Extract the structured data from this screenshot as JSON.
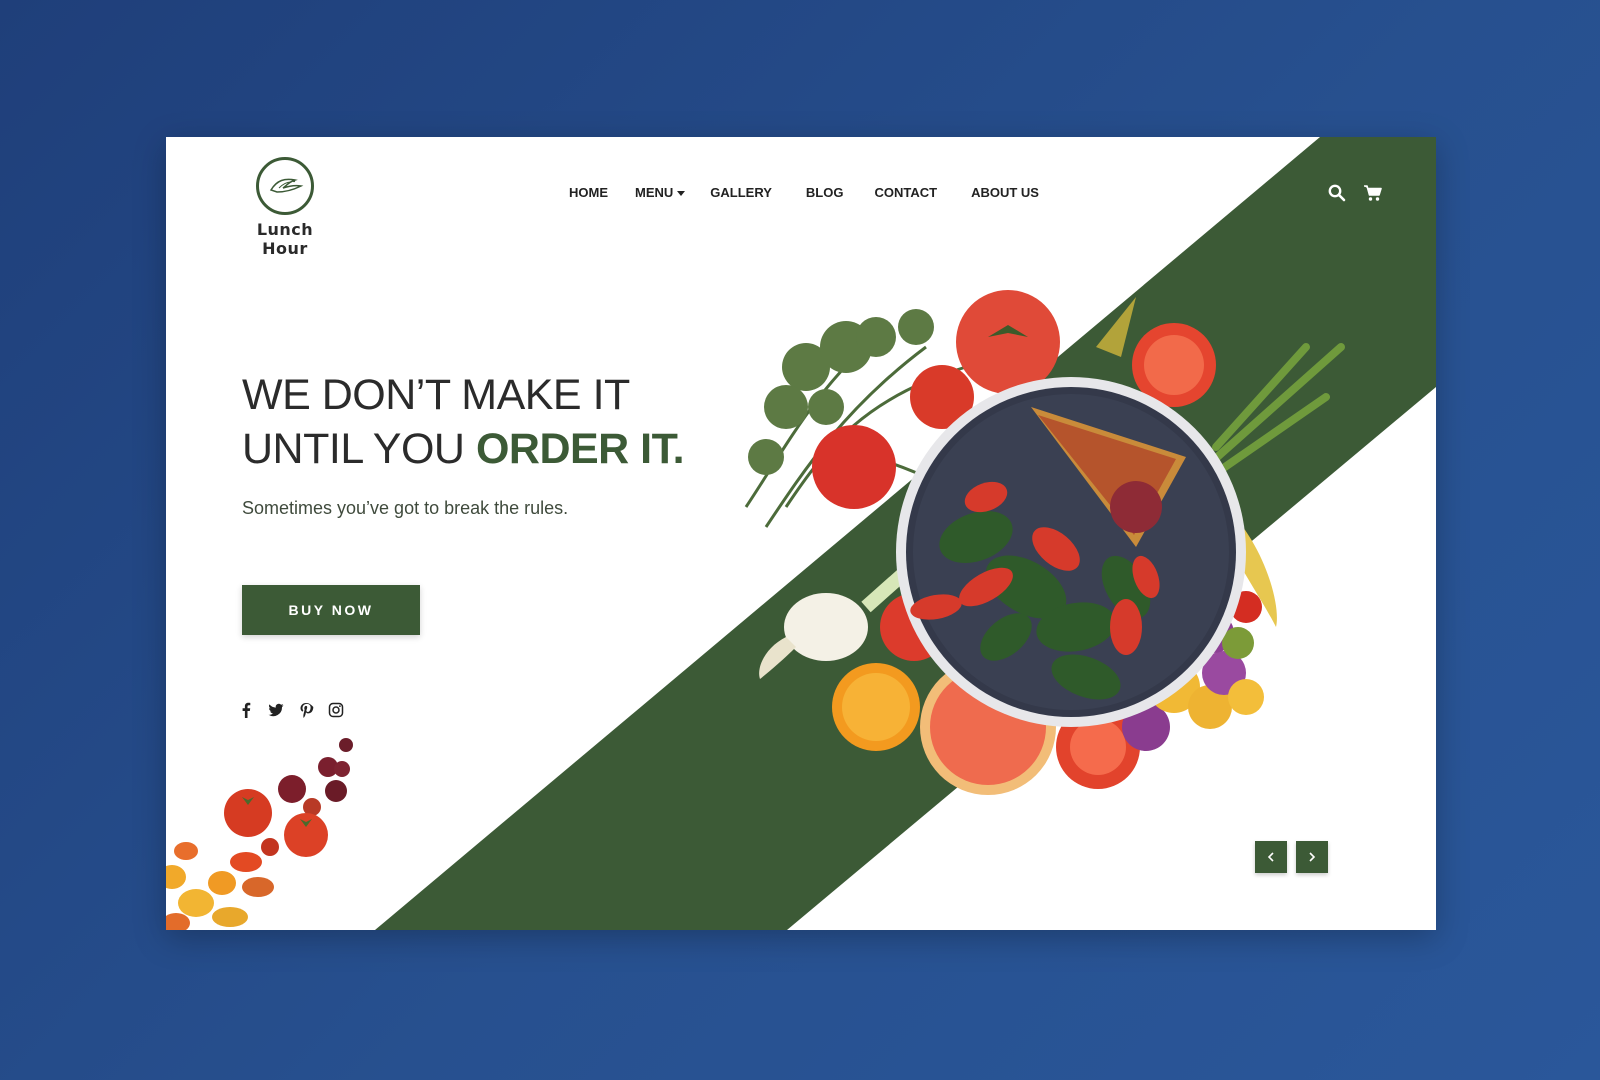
{
  "brand": {
    "name": "Lunch Hour",
    "logo_text": "LUNCH HOUR",
    "accent_color": "#3c5a36",
    "background_color": "#24478a"
  },
  "nav": {
    "items": [
      {
        "label": "HOME"
      },
      {
        "label": "MENU"
      },
      {
        "label": "GALLERY"
      },
      {
        "label": "BLOG"
      },
      {
        "label": "CONTACT"
      },
      {
        "label": "ABOUT US"
      }
    ]
  },
  "header_icons": [
    "search-icon",
    "cart-icon"
  ],
  "hero": {
    "headline_line1": "WE DON’T MAKE IT",
    "headline_line2_prefix": "UNTIL YOU ",
    "headline_emphasis": "ORDER IT.",
    "subheadline": "Sometimes you’ve got to break the rules.",
    "cta_label": "BUY NOW"
  },
  "social": [
    "facebook-icon",
    "twitter-icon",
    "pinterest-icon",
    "instagram-icon"
  ],
  "slider": {
    "prev_icon": "chevron-left-icon",
    "next_icon": "chevron-right-icon"
  }
}
